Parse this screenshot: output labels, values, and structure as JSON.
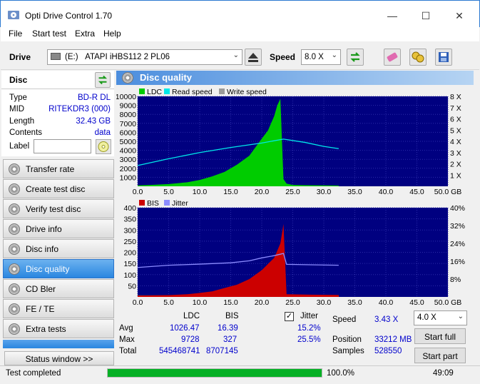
{
  "window": {
    "title": "Opti Drive Control 1.70"
  },
  "menu": [
    "File",
    "Start test",
    "Extra",
    "Help"
  ],
  "toolbar": {
    "drive_label": "Drive",
    "drive_letter": "(E:)",
    "drive_name": "ATAPI iHBS112   2 PL06",
    "speed_label": "Speed",
    "speed_value": "8.0 X"
  },
  "disc": {
    "header": "Disc",
    "type_label": "Type",
    "type_value": "BD-R DL",
    "mid_label": "MID",
    "mid_value": "RITEKDR3 (000)",
    "length_label": "Length",
    "length_value": "32.43 GB",
    "contents_label": "Contents",
    "contents_value": "data",
    "label_label": "Label",
    "label_value": ""
  },
  "nav": [
    "Transfer rate",
    "Create test disc",
    "Verify test disc",
    "Drive info",
    "Disc info",
    "Disc quality",
    "CD Bler",
    "FE / TE",
    "Extra tests"
  ],
  "status_window": "Status window >>",
  "panel_title": "Disc quality",
  "chart_data": [
    {
      "type": "area",
      "legend": [
        "LDC",
        "Read speed",
        "Write speed"
      ],
      "colors": {
        "LDC": "#00cc00",
        "Read speed": "#00e8e8",
        "Write speed": "#9a9a9a"
      },
      "x_ticks": [
        "0.0",
        "5.0",
        "10.0",
        "15.0",
        "20.0",
        "25.0",
        "30.0",
        "35.0",
        "40.0",
        "45.0",
        "50.0 GB"
      ],
      "xlim": [
        0,
        50
      ],
      "y_ticks": [
        "10000",
        "9000",
        "8000",
        "7000",
        "6000",
        "5000",
        "4000",
        "3000",
        "2000",
        "1000"
      ],
      "ylim": [
        0,
        10000
      ],
      "y2_ticks": [
        "8 X",
        "7 X",
        "6 X",
        "5 X",
        "4 X",
        "3 X",
        "2 X",
        "1 X"
      ],
      "y2lim": [
        0,
        8
      ],
      "ldc": {
        "x": [
          0,
          2,
          5,
          8,
          10,
          12,
          14,
          16,
          18,
          20,
          21,
          22,
          22.5,
          23,
          23.5,
          24,
          25,
          27,
          30,
          32.4
        ],
        "y": [
          100,
          150,
          250,
          450,
          700,
          1100,
          1600,
          2400,
          3400,
          5300,
          6200,
          7800,
          9000,
          9728,
          800,
          300,
          150,
          120,
          100,
          80
        ]
      },
      "read_speed": {
        "x": [
          0,
          5,
          10,
          15,
          20,
          23.5,
          27,
          30,
          32.4
        ],
        "y": [
          1.85,
          2.45,
          3.0,
          3.45,
          3.85,
          4.2,
          3.9,
          3.55,
          3.35
        ]
      }
    },
    {
      "type": "area",
      "legend": [
        "BIS",
        "Jitter"
      ],
      "colors": {
        "BIS": "#cc0000",
        "Jitter": "#8c8cff",
        "base": "#c8c800"
      },
      "x_ticks": [
        "0.0",
        "5.0",
        "10.0",
        "15.0",
        "20.0",
        "25.0",
        "30.0",
        "35.0",
        "40.0",
        "45.0",
        "50.0 GB"
      ],
      "xlim": [
        0,
        50
      ],
      "y_ticks": [
        "400",
        "350",
        "300",
        "250",
        "200",
        "150",
        "100",
        "50"
      ],
      "ylim": [
        0,
        400
      ],
      "y2_ticks": [
        "40%",
        "32%",
        "24%",
        "16%",
        "8%"
      ],
      "y2lim": [
        0,
        40
      ],
      "bis": {
        "x": [
          0,
          5,
          8,
          10,
          12,
          14,
          16,
          18,
          20,
          22,
          23,
          23.5,
          24,
          28,
          32.4
        ],
        "y": [
          6,
          8,
          12,
          18,
          25,
          40,
          55,
          80,
          120,
          175,
          240,
          327,
          12,
          10,
          9
        ]
      },
      "jitter": {
        "x": [
          0,
          5,
          10,
          15,
          18,
          20,
          22,
          23.5,
          24,
          28,
          32.4
        ],
        "y": [
          13.2,
          14.2,
          14.7,
          15.3,
          16.2,
          17.5,
          18.5,
          19.5,
          14.6,
          14.4,
          14.2
        ]
      }
    }
  ],
  "stats": {
    "col_ldc": "LDC",
    "col_bis": "BIS",
    "jitter_label": "Jitter",
    "avg_label": "Avg",
    "max_label": "Max",
    "total_label": "Total",
    "avg_ldc": "1026.47",
    "avg_bis": "16.39",
    "avg_jitter": "15.2%",
    "max_ldc": "9728",
    "max_bis": "327",
    "max_jitter": "25.5%",
    "total_ldc": "545468741",
    "total_bis": "8707145",
    "speed_label": "Speed",
    "speed_value": "3.43 X",
    "position_label": "Position",
    "position_value": "33212 MB",
    "samples_label": "Samples",
    "samples_value": "528550",
    "speed_select": "4.0 X",
    "start_full": "Start full",
    "start_part": "Start part"
  },
  "statusbar": {
    "text": "Test completed",
    "percent": "100.0%",
    "progress": 1.0,
    "time": "49:09"
  }
}
